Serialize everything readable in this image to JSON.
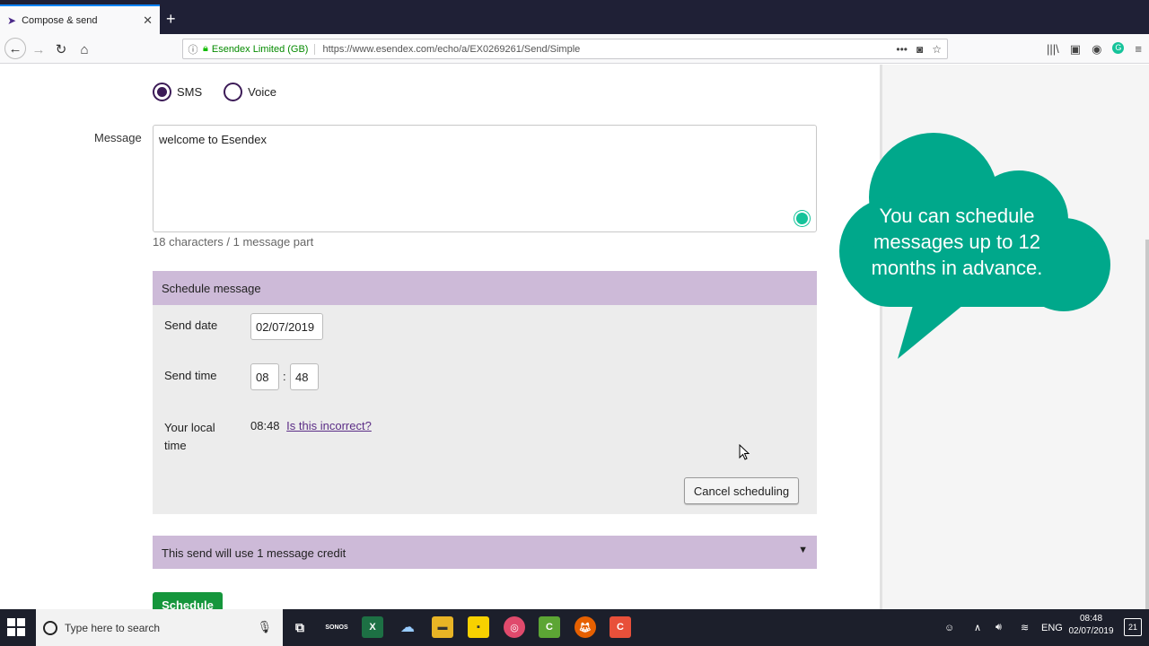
{
  "browser": {
    "tab_title": "Compose & send",
    "site_identity": "Esendex Limited (GB)",
    "url": "https://www.esendex.com/echo/a/EX0269261/Send/Simple"
  },
  "form": {
    "channel_options": [
      {
        "label": "SMS",
        "selected": true
      },
      {
        "label": "Voice",
        "selected": false
      }
    ],
    "message_label": "Message",
    "message_value": "welcome to Esendex",
    "char_count": "18 characters /  1 message part"
  },
  "schedule": {
    "header": "Schedule message",
    "send_date_label": "Send date",
    "send_date_value": "02/07/2019",
    "send_time_label": "Send time",
    "send_time_hour": "08",
    "send_time_minute": "48",
    "time_separator": ":",
    "local_time_label_line1": "Your local",
    "local_time_label_line2": "time",
    "local_time_value": "08:48",
    "incorrect_link": "Is this incorrect?",
    "cancel_button": "Cancel scheduling"
  },
  "credit_bar": {
    "text": "This send will use 1 message credit"
  },
  "schedule_button": "Schedule",
  "callout": {
    "line1": "You can schedule",
    "line2": "messages up to 12",
    "line3": "months in advance.",
    "color": "#00a88b"
  },
  "taskbar": {
    "search_placeholder": "Type here to search",
    "language": "ENG",
    "time": "08:48",
    "date": "02/07/2019",
    "notification_count": "21"
  },
  "colors": {
    "accent_purple": "#cdbad8",
    "radio_purple": "#3c1b57",
    "schedule_green": "#15963c"
  }
}
